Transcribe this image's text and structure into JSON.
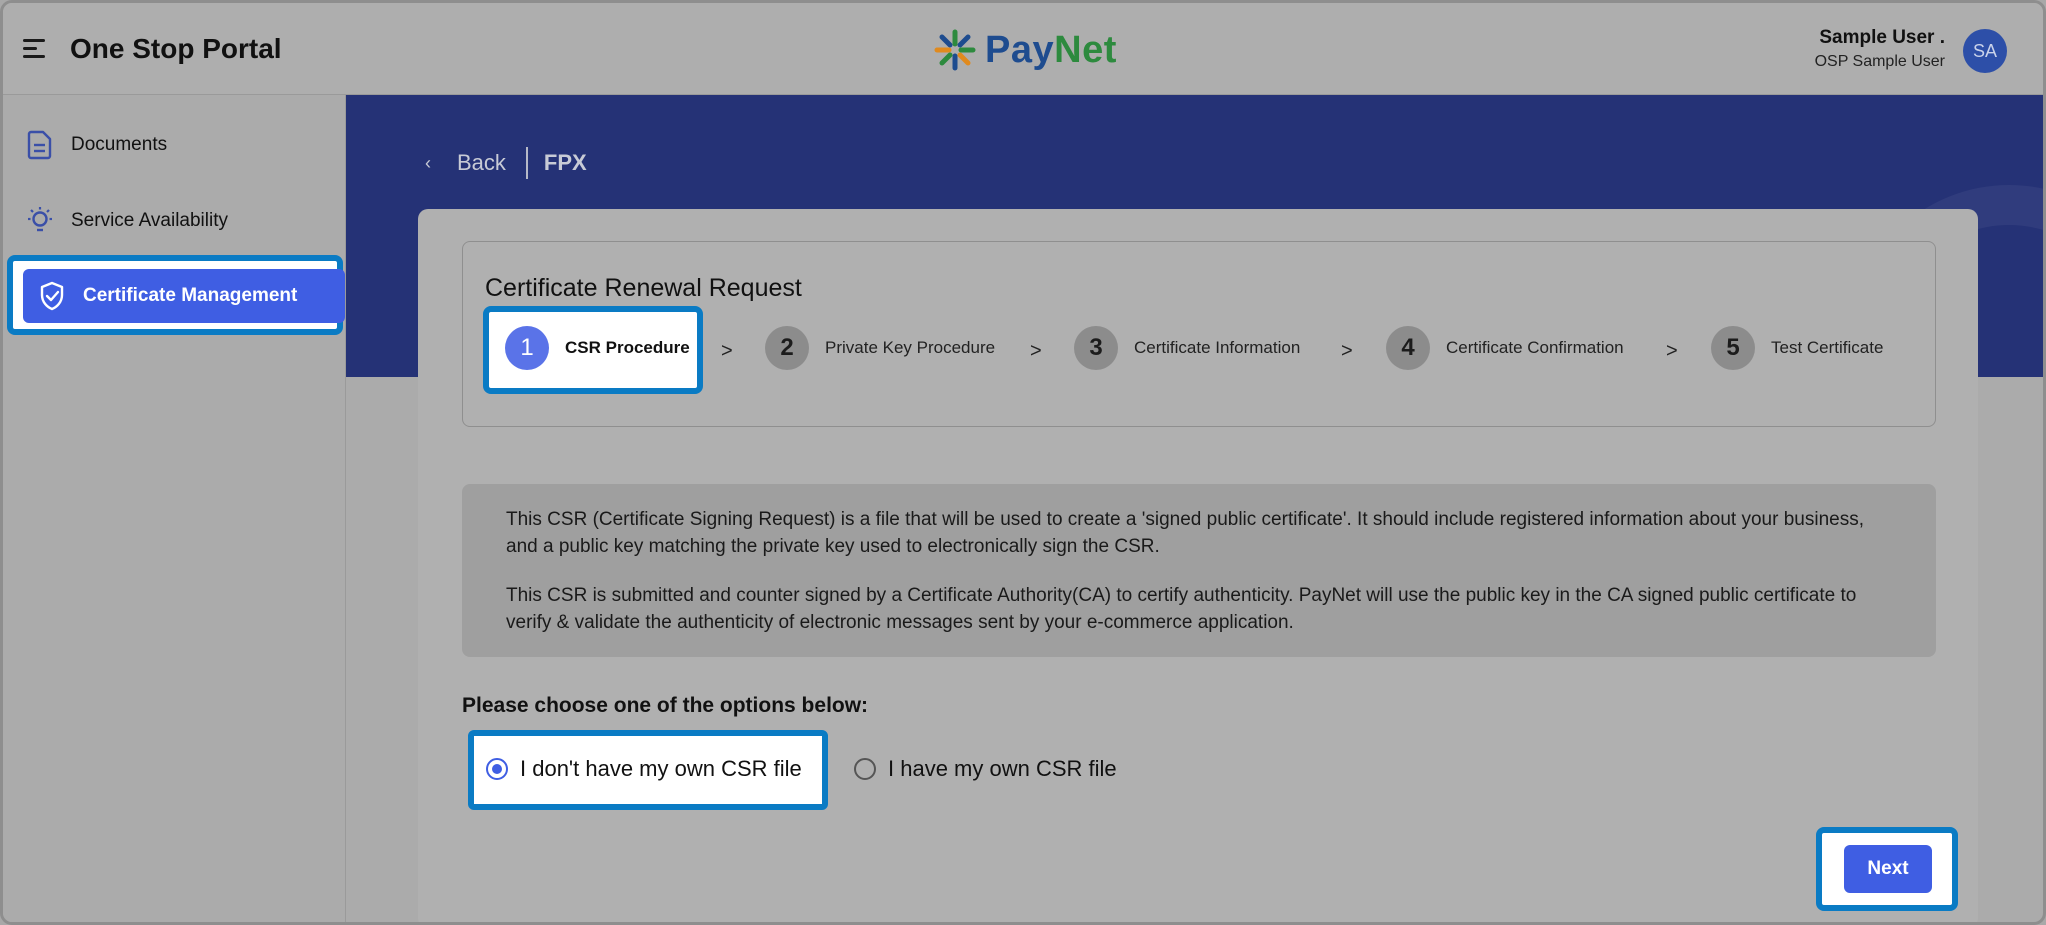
{
  "header": {
    "app_title": "One Stop Portal",
    "logo_text_pay": "Pay",
    "logo_text_net": "Net",
    "user_name": "Sample User .",
    "user_role": "OSP Sample User",
    "avatar_initials": "SA"
  },
  "sidebar": {
    "items": [
      {
        "label": "Documents",
        "icon": "document-icon"
      },
      {
        "label": "Service Availability",
        "icon": "lightbulb-icon"
      },
      {
        "label": "Certificate Management",
        "icon": "shield-check-icon",
        "active": true
      }
    ]
  },
  "nav": {
    "back_label": "Back",
    "breadcrumb": "FPX"
  },
  "stepper": {
    "title": "Certificate Renewal Request",
    "separator": ">",
    "steps": [
      {
        "number": "1",
        "label": "CSR Procedure",
        "active": true
      },
      {
        "number": "2",
        "label": "Private Key Procedure"
      },
      {
        "number": "3",
        "label": "Certificate Information"
      },
      {
        "number": "4",
        "label": "Certificate Confirmation"
      },
      {
        "number": "5",
        "label": "Test Certificate"
      }
    ]
  },
  "info": {
    "paragraph1": "This CSR (Certificate Signing Request) is a file that will be used to create a 'signed public certificate'. It should include registered information about your business, and a public key matching the private key used to electronically sign the CSR.",
    "paragraph2": "This CSR is submitted and counter signed by a Certificate Authority(CA) to certify authenticity. PayNet will use the public key in the CA signed public certificate to verify & validate the authenticity of electronic messages sent by your e-commerce application."
  },
  "options": {
    "prompt": "Please choose one of the options below:",
    "choices": [
      {
        "label": "I don't have my own CSR file",
        "selected": true
      },
      {
        "label": "I have my own CSR file",
        "selected": false
      }
    ]
  },
  "actions": {
    "next_label": "Next"
  },
  "colors": {
    "primary": "#3f5ee3",
    "highlight_outline": "#0a7bc4",
    "banner": "#253276",
    "logo_blue": "#1e4c8f",
    "logo_green": "#2d8a3e"
  }
}
